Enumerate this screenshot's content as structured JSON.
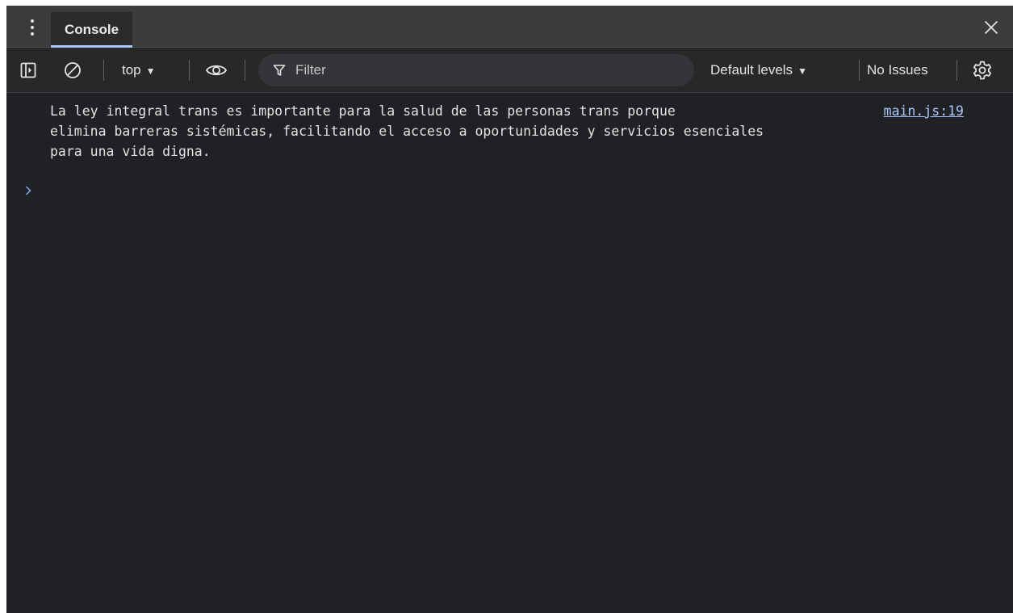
{
  "tabbar": {
    "tab_label": "Console"
  },
  "toolbar": {
    "context_label": "top",
    "filter_placeholder": "Filter",
    "levels_label": "Default levels",
    "issues_label": "No Issues"
  },
  "console": {
    "messages": [
      {
        "text": "La ley integral trans es importante para la salud de las personas trans porque\nelimina barreras sistémicas, facilitando el acceso a oportunidades y servicios esenciales\npara una vida digna.",
        "source": "main.js:19"
      }
    ]
  },
  "icons": {
    "menu": "kebab-menu-icon",
    "close": "close-icon",
    "sidebar": "sidebar-toggle-icon",
    "clear": "clear-console-icon",
    "eye": "live-expression-eye-icon",
    "filter": "filter-funnel-icon",
    "settings": "gear-icon",
    "prompt": "chevron-right-icon"
  },
  "colors": {
    "background": "#202124",
    "tab_strip": "#3c3c3c",
    "toolbar": "#282828",
    "text": "#e3e3e3",
    "link": "#a8c7fa",
    "accent": "#a8c7fa"
  }
}
